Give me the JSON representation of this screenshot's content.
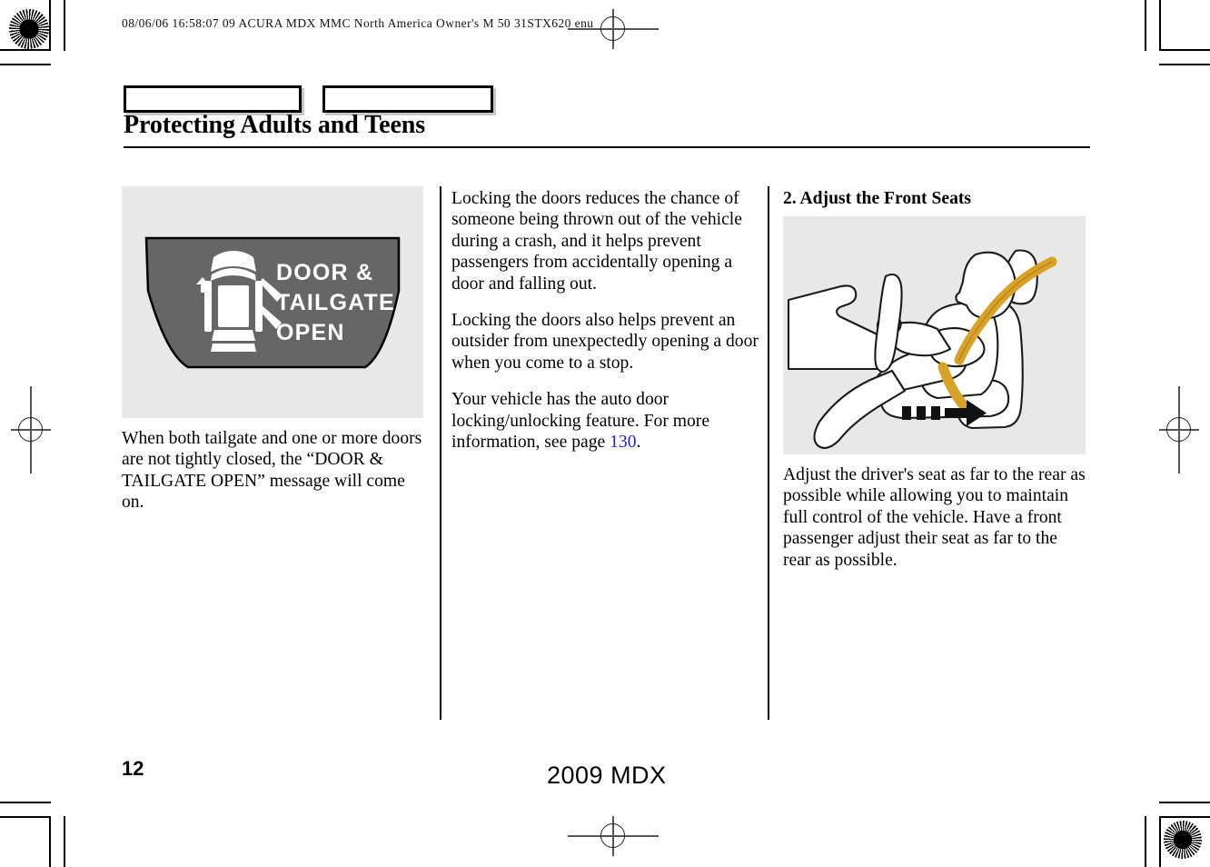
{
  "scan": {
    "header_line": "08/06/06 16:58:07    09 ACURA MDX MMC North America Owner's M 50 31STX620 enu"
  },
  "page": {
    "title": "Protecting Adults and Teens",
    "page_number": "12",
    "model_footer": "2009  MDX",
    "link_color": "#2222dd",
    "figure_bg": "#e8e8e8",
    "display_bg": "#666666",
    "seatbelt_color": "#d9a227"
  },
  "tabs": [
    {
      "name": "tab-box-left",
      "label": ""
    },
    {
      "name": "tab-box-right",
      "label": ""
    }
  ],
  "columns": {
    "left": {
      "figure": {
        "name": "door-tailgate-open-display",
        "display_lines": [
          "DOOR &",
          "TAILGATE",
          "OPEN"
        ],
        "icon": "car-top-view-doors-open-icon"
      },
      "caption": "When both tailgate and one or more doors are not tightly closed, the “DOOR & TAILGATE OPEN” message will come on."
    },
    "middle": {
      "paragraphs": [
        "Locking the doors reduces the chance of someone being thrown out of the vehicle during a crash, and it helps prevent passengers from accidentally opening a door and falling out.",
        "Locking the doors also helps prevent an outsider from unexpectedly opening a door when you come to a stop."
      ],
      "last_paragraph": {
        "before_link": "Your vehicle has the auto door locking/unlocking feature. For more information, see page ",
        "link_text": "130",
        "after_link": "."
      }
    },
    "right": {
      "heading": "2. Adjust the Front Seats",
      "figure": {
        "name": "driver-seat-adjust-illustration",
        "description": "seated-driver-with-seatbelt-and-rearward-arrow"
      },
      "caption": "Adjust the driver's seat as far to the rear as possible while allowing you to maintain full control of the vehicle. Have a front passenger adjust their seat as far to the rear as possible."
    }
  }
}
